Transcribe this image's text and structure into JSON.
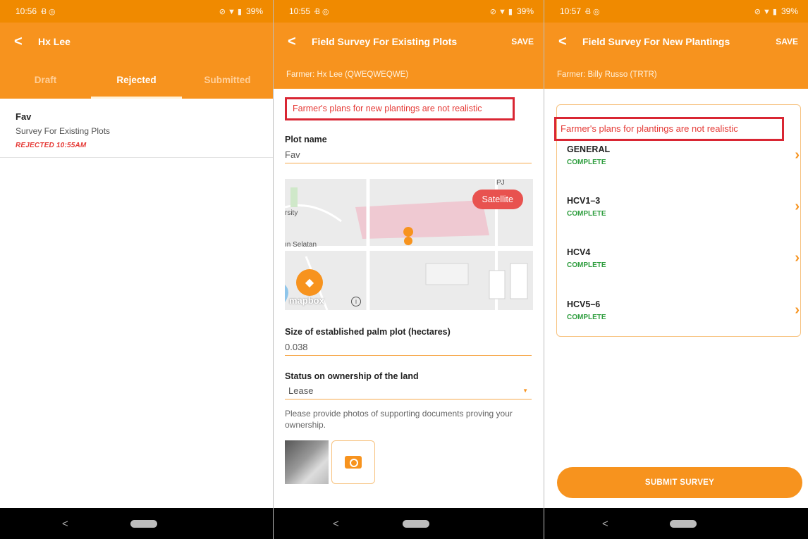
{
  "screen1": {
    "status": {
      "time": "10:56",
      "battery": "39%"
    },
    "appbar": {
      "back": "<",
      "title": "Hx Lee"
    },
    "tabs": [
      {
        "label": "Draft"
      },
      {
        "label": "Rejected"
      },
      {
        "label": "Submitted"
      }
    ],
    "active_tab": "Rejected",
    "list": [
      {
        "title": "Fav",
        "subtitle": "Survey For Existing Plots",
        "status": "REJECTED 10:55AM"
      }
    ]
  },
  "screen2": {
    "status": {
      "time": "10:55",
      "battery": "39%"
    },
    "appbar": {
      "back": "<",
      "title": "Field Survey For Existing Plots",
      "save": "SAVE"
    },
    "farmer": "Farmer: Hx Lee (QWEQWEQWE)",
    "error": "Farmer's plans for new plantings are not realistic",
    "plot_name": {
      "label": "Plot name",
      "value": "Fav"
    },
    "map": {
      "satellite_label": "Satellite",
      "labels": [
        "rsity",
        "ın Selatan",
        "PJ"
      ],
      "attribution": "mapbox"
    },
    "size": {
      "label": "Size of established palm plot (hectares)",
      "value": "0.038"
    },
    "ownership": {
      "label": "Status on ownership of the land",
      "value": "Lease"
    },
    "photos_help": "Please provide photos of supporting documents proving your ownership."
  },
  "screen3": {
    "status": {
      "time": "10:57",
      "battery": "39%"
    },
    "appbar": {
      "back": "<",
      "title": "Field Survey For New Plantings",
      "save": "SAVE"
    },
    "farmer": "Farmer: Billy Russo (TRTR)",
    "error": "Farmer's plans for plantings are not realistic",
    "sections": [
      {
        "name": "GENERAL",
        "status": "COMPLETE"
      },
      {
        "name": "HCV1–3",
        "status": "COMPLETE"
      },
      {
        "name": "HCV4",
        "status": "COMPLETE"
      },
      {
        "name": "HCV5–6",
        "status": "COMPLETE"
      }
    ],
    "submit_label": "SUBMIT SURVEY"
  },
  "nav": {
    "back": "<"
  },
  "colors": {
    "accent": "#f7931e",
    "error": "#e53935",
    "complete": "#2e9d3e",
    "highlight_box": "#d92633"
  }
}
